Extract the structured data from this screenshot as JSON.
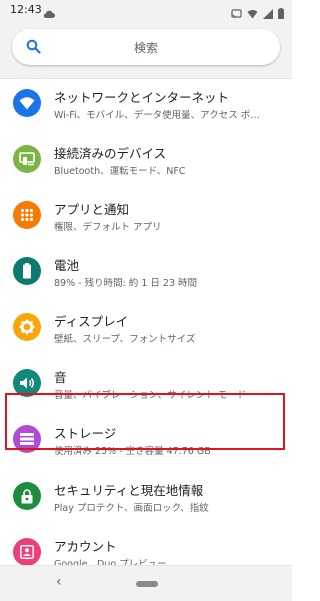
{
  "status_bar": {
    "time": "12:43",
    "icons": [
      "cloud-icon",
      "cast-icon",
      "wifi-icon",
      "cell-signal-icon",
      "battery-icon"
    ]
  },
  "search": {
    "placeholder": "検索"
  },
  "settings": [
    {
      "title": "ネットワークとインターネット",
      "subtitle": "Wi-Fi、モバイル、データ使用量、アクセス ポ…",
      "icon": "wifi-icon",
      "color": "#1a73e8"
    },
    {
      "title": "接続済みのデバイス",
      "subtitle": "Bluetooth、運転モード、NFC",
      "icon": "devices-icon",
      "color": "#7cb342"
    },
    {
      "title": "アプリと通知",
      "subtitle": "権限、デフォルト アプリ",
      "icon": "apps-icon",
      "color": "#f57c00"
    },
    {
      "title": "電池",
      "subtitle": "89% - 残り時間: 約 1 日 23 時間",
      "icon": "battery-icon",
      "color": "#0d7a6f"
    },
    {
      "title": "ディスプレイ",
      "subtitle": "壁紙、スリープ、フォントサイズ",
      "icon": "brightness-icon",
      "color": "#f6a609"
    },
    {
      "title": "音",
      "subtitle": "音量、バイブレーション、サイレント モード",
      "icon": "volume-icon",
      "color": "#12877a"
    },
    {
      "title": "ストレージ",
      "subtitle": "使用済み 25% - 空き容量 47.76 GB",
      "icon": "storage-icon",
      "color": "#b24ad6"
    },
    {
      "title": "セキュリティと現在地情報",
      "subtitle": "Play プロテクト、画面ロック、指紋",
      "icon": "lock-icon",
      "color": "#1e8e3e"
    },
    {
      "title": "アカウント",
      "subtitle": "Google、Duo プレビュー",
      "icon": "account-icon",
      "color": "#ec407a"
    }
  ],
  "highlight_color": "#e0141e",
  "nav": {
    "back_glyph": "‹"
  }
}
